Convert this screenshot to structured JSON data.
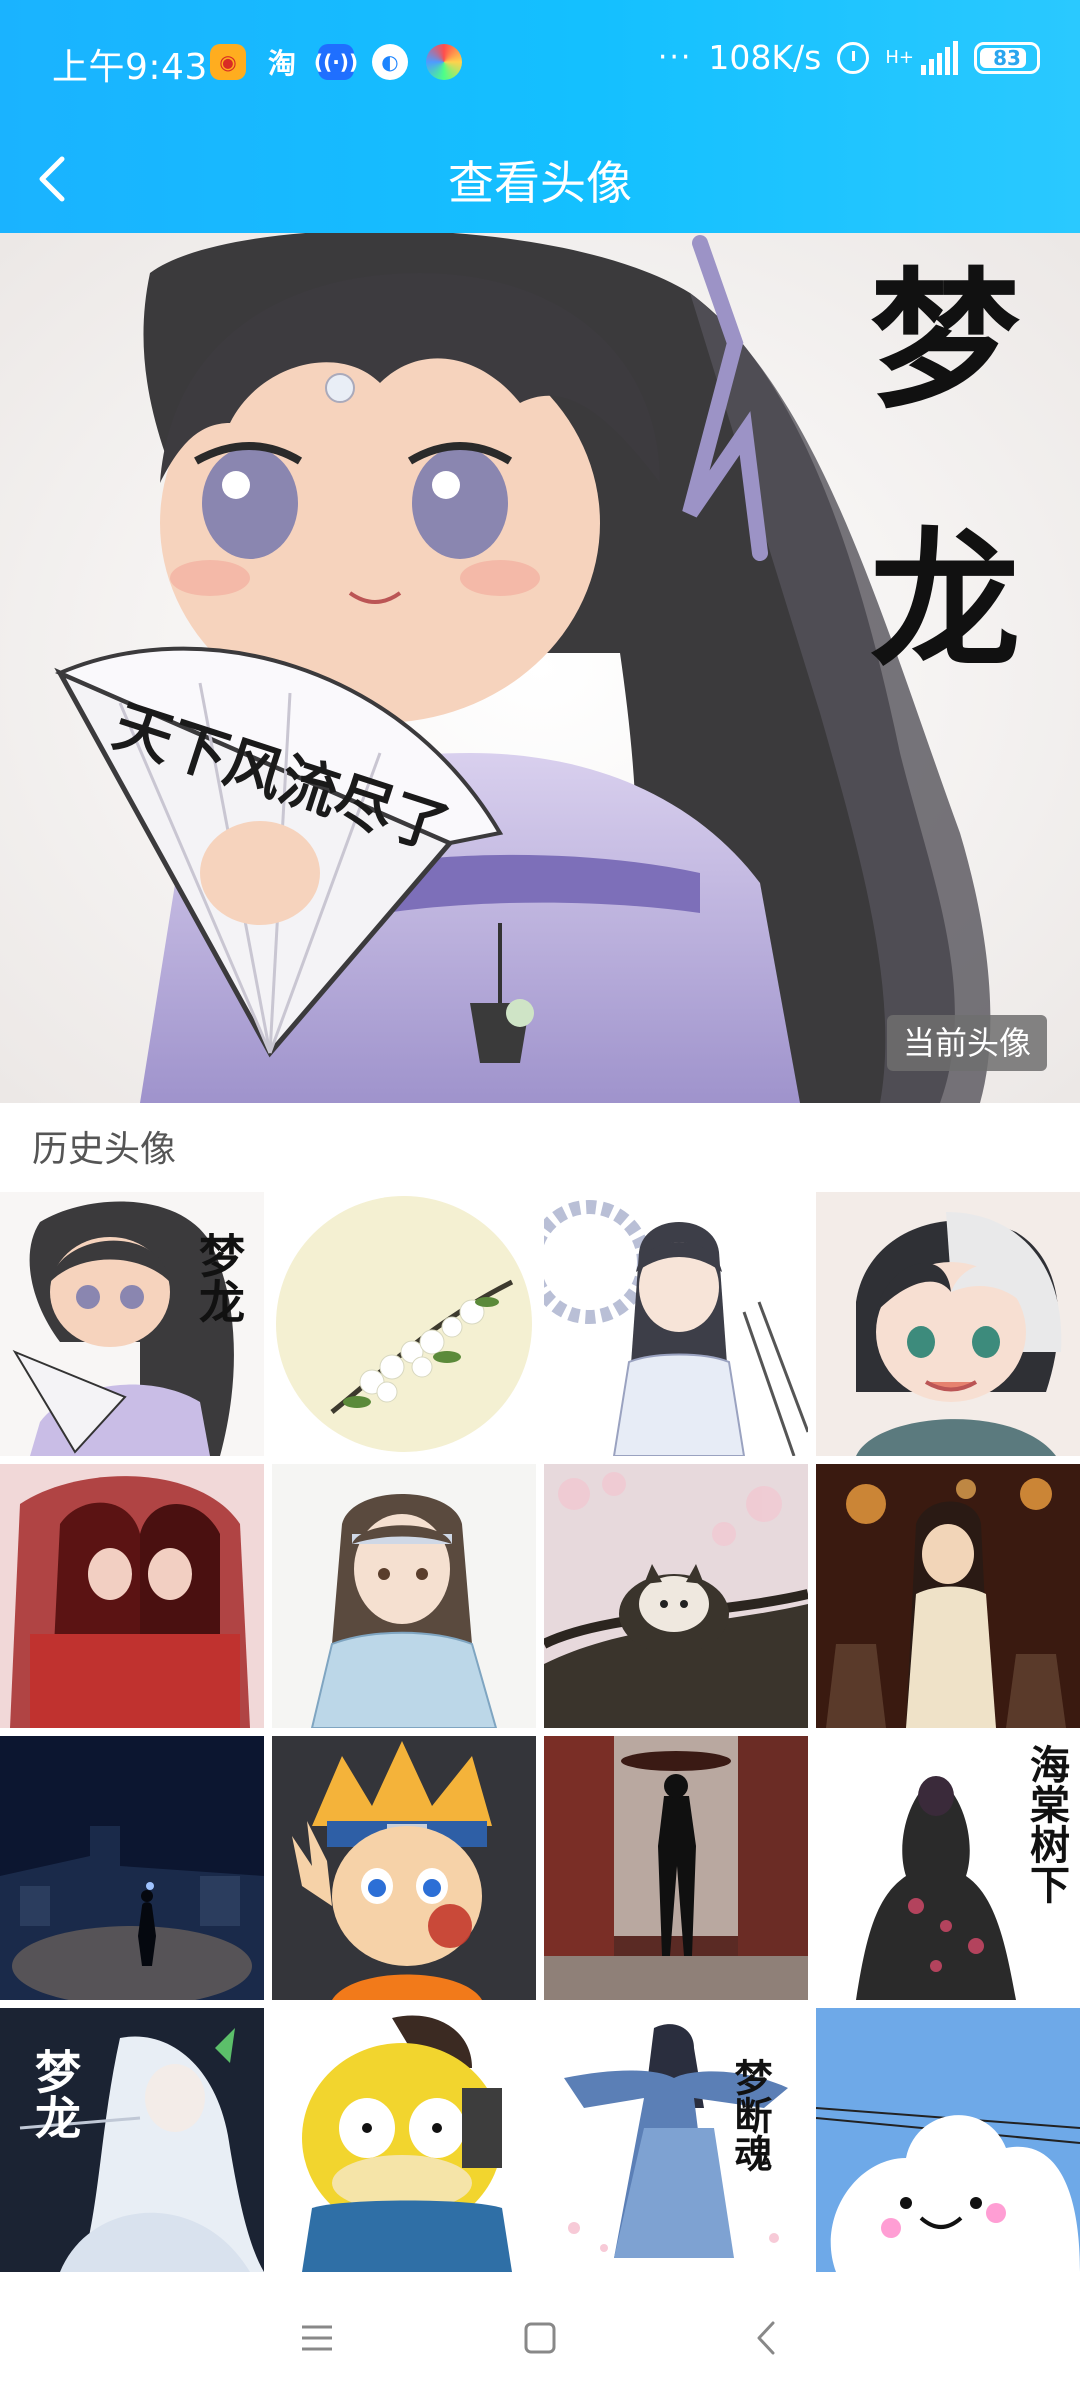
{
  "status_bar": {
    "time": "上午9:43",
    "left_icons": [
      "weibo-icon",
      "taobao-icon",
      "wifi-hotspot-icon",
      "browser-icon",
      "color-app-icon"
    ],
    "more": "···",
    "net_speed": "108K/s",
    "network_type": "H+",
    "battery": "83",
    "battery_level": 0.83
  },
  "header": {
    "title": "查看头像",
    "back_icon": "chevron-left-icon"
  },
  "current_avatar": {
    "badge": "当前头像",
    "image_text": {
      "fan_text": "天下风流尽了",
      "side_text": "梦龙"
    }
  },
  "history": {
    "title": "历史头像",
    "items": [
      {
        "name": "anime-girl-fan-avatar",
        "text": "梦龙"
      },
      {
        "name": "plum-blossom-circle-avatar",
        "text": ""
      },
      {
        "name": "anime-swordsman-white-avatar",
        "text": ""
      },
      {
        "name": "anime-boy-two-tone-hair-avatar",
        "text": ""
      },
      {
        "name": "red-veil-couple-avatar",
        "text": ""
      },
      {
        "name": "anime-boy-blue-robe-avatar",
        "text": ""
      },
      {
        "name": "cat-on-branch-avatar",
        "text": ""
      },
      {
        "name": "lantern-night-avatar",
        "text": ""
      },
      {
        "name": "night-street-walker-avatar",
        "text": ""
      },
      {
        "name": "naruto-avatar",
        "text": ""
      },
      {
        "name": "person-in-alley-avatar",
        "text": ""
      },
      {
        "name": "ink-haitang-avatar",
        "text": "海棠树下"
      },
      {
        "name": "white-hair-swordsman-avatar",
        "text": "梦龙"
      },
      {
        "name": "psyduck-avatar",
        "text": ""
      },
      {
        "name": "blue-robe-back-avatar",
        "text": "梦断魂"
      },
      {
        "name": "smiling-cloud-avatar",
        "text": ""
      }
    ]
  },
  "nav": {
    "menu_icon": "menu-icon",
    "home_icon": "home-icon",
    "back_icon": "back-icon"
  },
  "colors": {
    "header_start": "#1ab3ff",
    "header_end": "#2ac9ff",
    "badge_bg": "#6e6e6e"
  }
}
